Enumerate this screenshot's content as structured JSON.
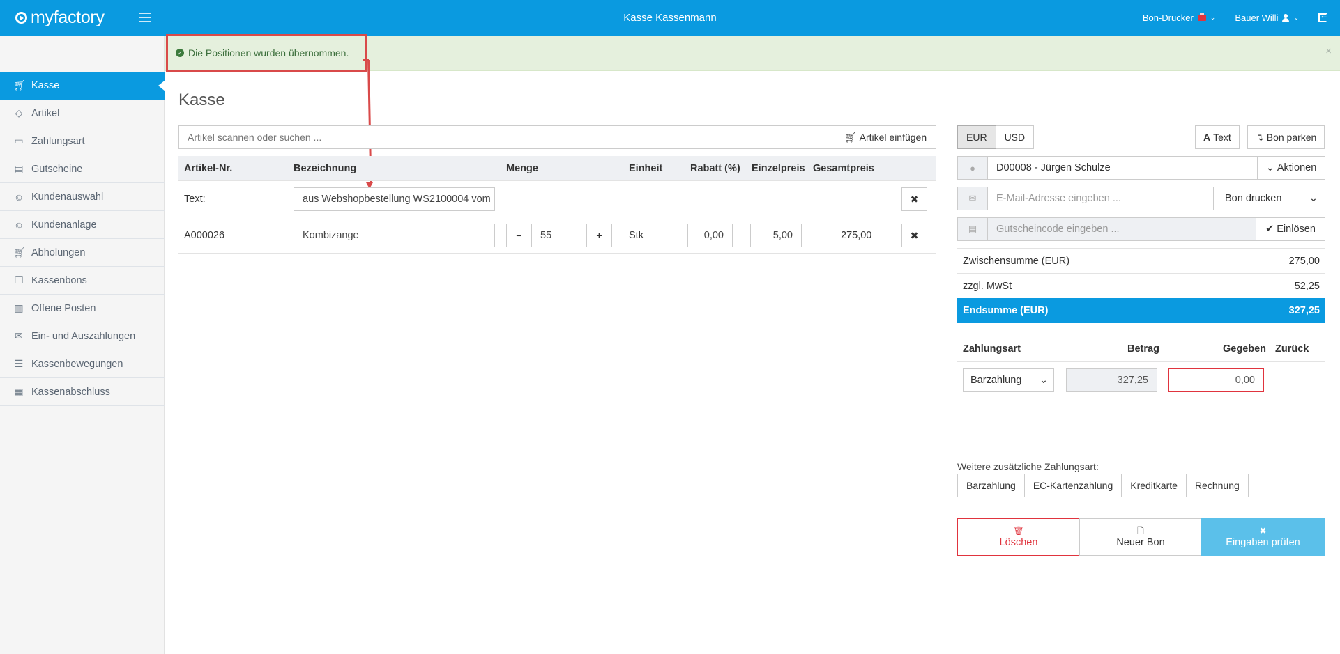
{
  "topbar": {
    "logo": "myfactory",
    "title": "Kasse Kassenmann",
    "printer_label": "Bon-Drucker",
    "user_label": "Bauer Willi"
  },
  "sidebar": {
    "items": [
      {
        "label": "Kasse",
        "icon": "cart-icon",
        "active": true
      },
      {
        "label": "Artikel",
        "icon": "tag-icon"
      },
      {
        "label": "Zahlungsart",
        "icon": "folder-icon"
      },
      {
        "label": "Gutscheine",
        "icon": "gift-icon"
      },
      {
        "label": "Kundenauswahl",
        "icon": "user-icon"
      },
      {
        "label": "Kundenanlage",
        "icon": "user-icon"
      },
      {
        "label": "Abholungen",
        "icon": "cart-icon"
      },
      {
        "label": "Kassenbons",
        "icon": "copy-icon"
      },
      {
        "label": "Offene Posten",
        "icon": "book-icon"
      },
      {
        "label": "Ein- und Auszahlungen",
        "icon": "inbox-icon"
      },
      {
        "label": "Kassenbewegungen",
        "icon": "list-icon"
      },
      {
        "label": "Kassenabschluss",
        "icon": "calculator-icon"
      }
    ]
  },
  "alert": {
    "message": "Die Positionen wurden übernommen.",
    "close": "×"
  },
  "page_title": "Kasse",
  "search": {
    "placeholder": "Artikel scannen oder suchen ...",
    "button": "Artikel einfügen"
  },
  "table": {
    "headers": [
      "Artikel-Nr.",
      "Bezeichnung",
      "Menge",
      "Einheit",
      "Rabatt (%)",
      "Einzelpreis",
      "Gesamtpreis"
    ],
    "text_row": {
      "label": "Text:",
      "value": "aus Webshopbestellung WS2100004 vom"
    },
    "item_row": {
      "article_no": "A000026",
      "name": "Kombizange",
      "quantity": "55",
      "unit": "Stk",
      "discount": "0,00",
      "unit_price": "5,00",
      "total": "275,00"
    }
  },
  "right": {
    "currencies": [
      "EUR",
      "USD"
    ],
    "text_button": "Text",
    "park_button": "Bon parken",
    "customer": "D00008 - Jürgen Schulze",
    "actions_button": "Aktionen",
    "email_placeholder": "E-Mail-Adresse eingeben ...",
    "print_select": "Bon drucken",
    "voucher_placeholder": "Gutscheincode eingeben ...",
    "redeem_button": "Einlösen",
    "subtotal_label": "Zwischensumme (EUR)",
    "subtotal_value": "275,00",
    "vat_label": "zzgl. MwSt",
    "vat_value": "52,25",
    "total_label": "Endsumme (EUR)",
    "total_value": "327,25",
    "payment_headers": [
      "Zahlungsart",
      "Betrag",
      "Gegeben",
      "Zurück"
    ],
    "payment_method": "Barzahlung",
    "payment_amount": "327,25",
    "payment_given": "0,00",
    "more_label": "Weitere zusätzliche Zahlungsart:",
    "more_methods": [
      "Barzahlung",
      "EC-Kartenzahlung",
      "Kreditkarte",
      "Rechnung"
    ],
    "delete_button": "Löschen",
    "new_bon_button": "Neuer Bon",
    "check_button": "Eingaben prüfen"
  },
  "colors": {
    "primary": "#0a9ae0",
    "success_bg": "#e5f0dd",
    "danger": "#e0343e",
    "highlight": "#d94a4a"
  }
}
